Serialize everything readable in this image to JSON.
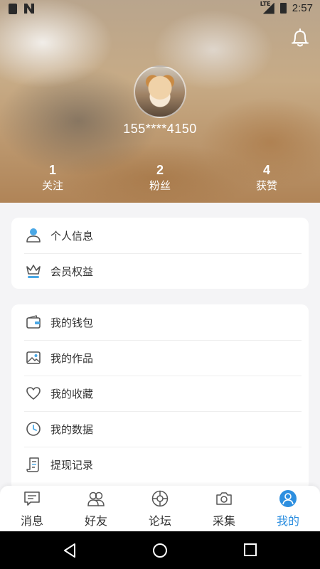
{
  "status_bar": {
    "time": "2:57",
    "network": "LTE"
  },
  "profile": {
    "username": "155****4150",
    "stats": [
      {
        "value": "1",
        "label": "关注"
      },
      {
        "value": "2",
        "label": "粉丝"
      },
      {
        "value": "4",
        "label": "获赞"
      }
    ]
  },
  "menu_group_1": [
    {
      "label": "个人信息",
      "icon": "person-icon"
    },
    {
      "label": "会员权益",
      "icon": "crown-icon"
    }
  ],
  "menu_group_2": [
    {
      "label": "我的钱包",
      "icon": "wallet-icon"
    },
    {
      "label": "我的作品",
      "icon": "image-icon"
    },
    {
      "label": "我的收藏",
      "icon": "heart-icon"
    },
    {
      "label": "我的数据",
      "icon": "clock-icon"
    },
    {
      "label": "提现记录",
      "icon": "scroll-icon"
    }
  ],
  "tabs": [
    {
      "label": "消息",
      "icon": "message-icon"
    },
    {
      "label": "好友",
      "icon": "friends-icon"
    },
    {
      "label": "论坛",
      "icon": "forum-icon"
    },
    {
      "label": "采集",
      "icon": "camera-icon"
    },
    {
      "label": "我的",
      "icon": "profile-icon",
      "active": true
    }
  ],
  "colors": {
    "accent": "#2d8fe0",
    "icon_blue": "#4aa8e6",
    "icon_gray": "#555555"
  }
}
